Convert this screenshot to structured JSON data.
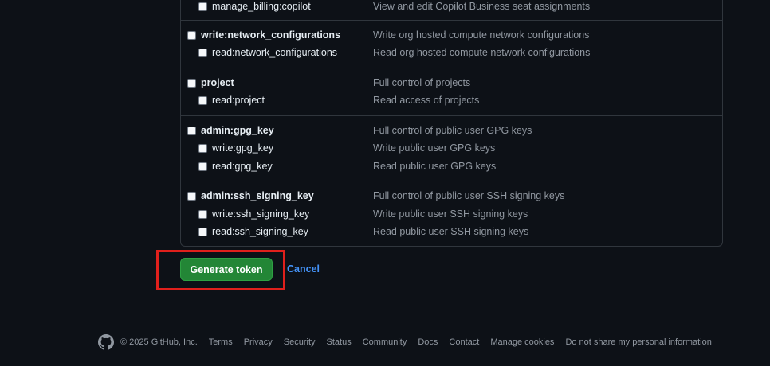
{
  "scope_groups": [
    {
      "items": [
        {
          "name": "manage_billing:copilot",
          "desc": "View and edit Copilot Business seat assignments",
          "parent": false
        }
      ]
    },
    {
      "items": [
        {
          "name": "write:network_configurations",
          "desc": "Write org hosted compute network configurations",
          "parent": true
        },
        {
          "name": "read:network_configurations",
          "desc": "Read org hosted compute network configurations",
          "parent": false
        }
      ]
    },
    {
      "items": [
        {
          "name": "project",
          "desc": "Full control of projects",
          "parent": true
        },
        {
          "name": "read:project",
          "desc": "Read access of projects",
          "parent": false
        }
      ]
    },
    {
      "items": [
        {
          "name": "admin:gpg_key",
          "desc": "Full control of public user GPG keys",
          "parent": true
        },
        {
          "name": "write:gpg_key",
          "desc": "Write public user GPG keys",
          "parent": false
        },
        {
          "name": "read:gpg_key",
          "desc": "Read public user GPG keys",
          "parent": false
        }
      ]
    },
    {
      "items": [
        {
          "name": "admin:ssh_signing_key",
          "desc": "Full control of public user SSH signing keys",
          "parent": true
        },
        {
          "name": "write:ssh_signing_key",
          "desc": "Write public user SSH signing keys",
          "parent": false
        },
        {
          "name": "read:ssh_signing_key",
          "desc": "Read public user SSH signing keys",
          "parent": false
        }
      ]
    }
  ],
  "actions": {
    "generate_label": "Generate token",
    "cancel_label": "Cancel"
  },
  "footer": {
    "logo_icon": "github-mark-icon",
    "copyright": "© 2025 GitHub, Inc.",
    "links": [
      "Terms",
      "Privacy",
      "Security",
      "Status",
      "Community",
      "Docs",
      "Contact",
      "Manage cookies",
      "Do not share my personal information"
    ]
  },
  "colors": {
    "background": "#0d1117",
    "primary_button": "#238636",
    "link": "#4493f8",
    "highlight_box": "#e0201c"
  }
}
